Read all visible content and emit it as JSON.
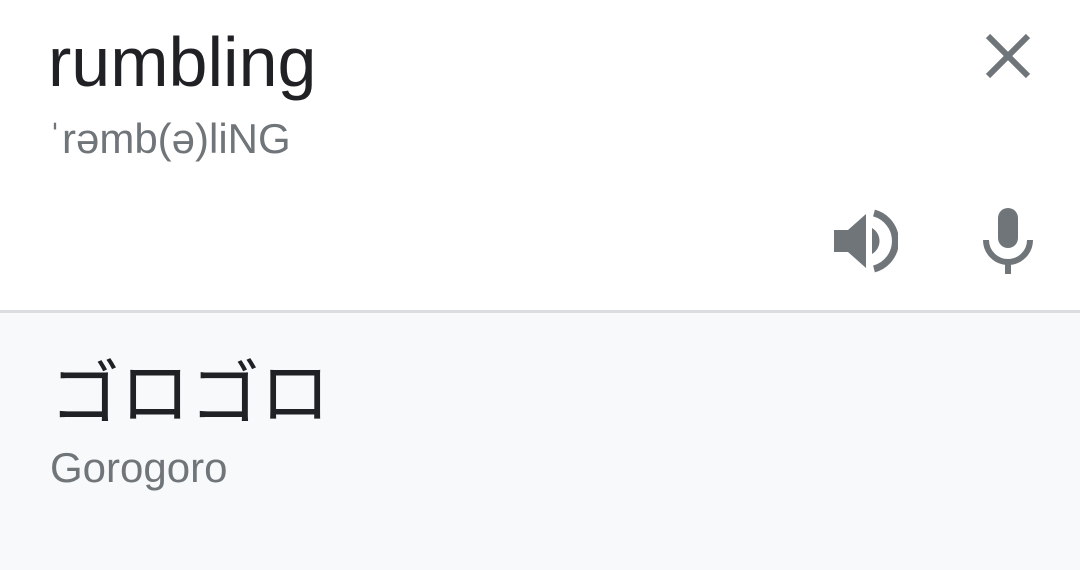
{
  "source": {
    "word": "rumbling",
    "phonetic": "ˈrəmb(ə)liNG"
  },
  "result": {
    "translation": "ゴロゴロ",
    "romanization": "Gorogoro"
  },
  "icons": {
    "close": "close-icon",
    "speaker": "volume-up-icon",
    "microphone": "microphone-icon"
  },
  "colors": {
    "primary_text": "#202124",
    "secondary_text": "#70757a",
    "icon": "#70757a",
    "result_background": "#f8f9fa",
    "divider": "#dadce0"
  }
}
